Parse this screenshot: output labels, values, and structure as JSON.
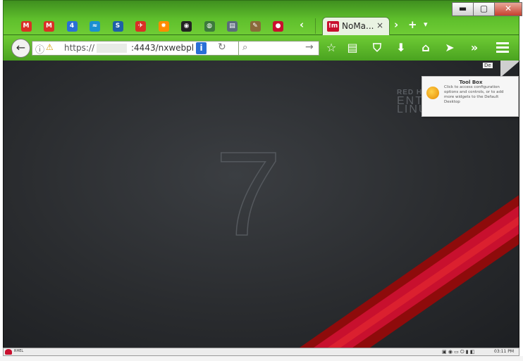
{
  "window": {
    "minimize_icon": "minimize-icon",
    "maximize_icon": "maximize-icon",
    "close_icon": "close-icon",
    "minimize_glyph": "▬",
    "maximize_glyph": "▢",
    "close_glyph": "✕"
  },
  "pinned_tabs": [
    {
      "icon": "gmail-icon",
      "glyph": "M",
      "color": "#d93025"
    },
    {
      "icon": "gmail-icon",
      "glyph": "M",
      "color": "#d93025"
    },
    {
      "icon": "calendar-icon",
      "glyph": "4",
      "color": "#2a6fd6"
    },
    {
      "icon": "wave-icon",
      "glyph": "≈",
      "color": "#1b8fd1"
    },
    {
      "icon": "s-icon",
      "glyph": "S",
      "color": "#1e5fa8"
    },
    {
      "icon": "plane-icon",
      "glyph": "✈",
      "color": "#d93025"
    },
    {
      "icon": "sun-icon",
      "glyph": "✹",
      "color": "#ff8c00"
    },
    {
      "icon": "puzzle-icon",
      "glyph": "◉",
      "color": "#222222"
    },
    {
      "icon": "globe-icon",
      "glyph": "◍",
      "color": "#3c7a3c"
    },
    {
      "icon": "screen-icon",
      "glyph": "▤",
      "color": "#5b6b7b"
    },
    {
      "icon": "book-icon",
      "glyph": "✎",
      "color": "#8a6a3a"
    },
    {
      "icon": "redhat-icon",
      "glyph": "●",
      "color": "#c8102e"
    }
  ],
  "active_tab": {
    "favicon_text": "!m",
    "title": "NoMa...",
    "close": "×"
  },
  "tab_controls": {
    "scroll_left": "‹",
    "scroll_right": "›",
    "new_tab": "+",
    "list_tabs": "▾"
  },
  "navbar": {
    "back": "←",
    "url_scheme": "https://",
    "url_rest": ":4443/nxwebpl",
    "page_info_glyph": "i",
    "reload": "↻",
    "search_go": "→",
    "toolbar": [
      {
        "name": "bookmark-star-button",
        "glyph": "☆"
      },
      {
        "name": "reading-list-button",
        "glyph": "▤"
      },
      {
        "name": "pocket-button",
        "glyph": "⛉"
      },
      {
        "name": "downloads-button",
        "glyph": "⬇"
      },
      {
        "name": "home-button",
        "glyph": "⌂"
      },
      {
        "name": "send-button",
        "glyph": "➤"
      },
      {
        "name": "overflow-button",
        "glyph": "»"
      }
    ]
  },
  "desktop": {
    "version_numeral": "7",
    "brand_line1": "RED H",
    "brand_line2": "ENTE",
    "brand_line3": "LINU",
    "tooltip_corner_label": "De",
    "tooltip_title": "Tool Box",
    "tooltip_body": "Click to access configuration options and controls, or to add more widgets to the Default Desktop"
  },
  "taskbar": {
    "start_label": "RHEL",
    "clock": "03:11 PM"
  },
  "colors": {
    "chrome_green": "#5fbf2c",
    "desktop_bg": "#2a2c2f",
    "stripe_red": "#c8102e"
  }
}
